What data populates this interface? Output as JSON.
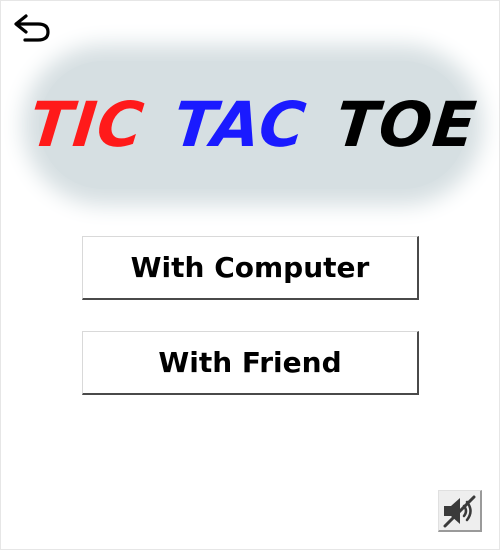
{
  "header": {
    "back_icon": "undo-arrow-icon"
  },
  "title": {
    "words": [
      {
        "text": "TIC",
        "color": "#ff1a1a"
      },
      {
        "text": "TAC",
        "color": "#1a1aff"
      },
      {
        "text": "TOE",
        "color": "#000000"
      }
    ],
    "panel_color": "#d6dfe2"
  },
  "menu": {
    "with_computer_label": "With Computer",
    "with_friend_label": "With Friend"
  },
  "sound": {
    "icon": "speaker-muted-icon",
    "state": "muted"
  }
}
